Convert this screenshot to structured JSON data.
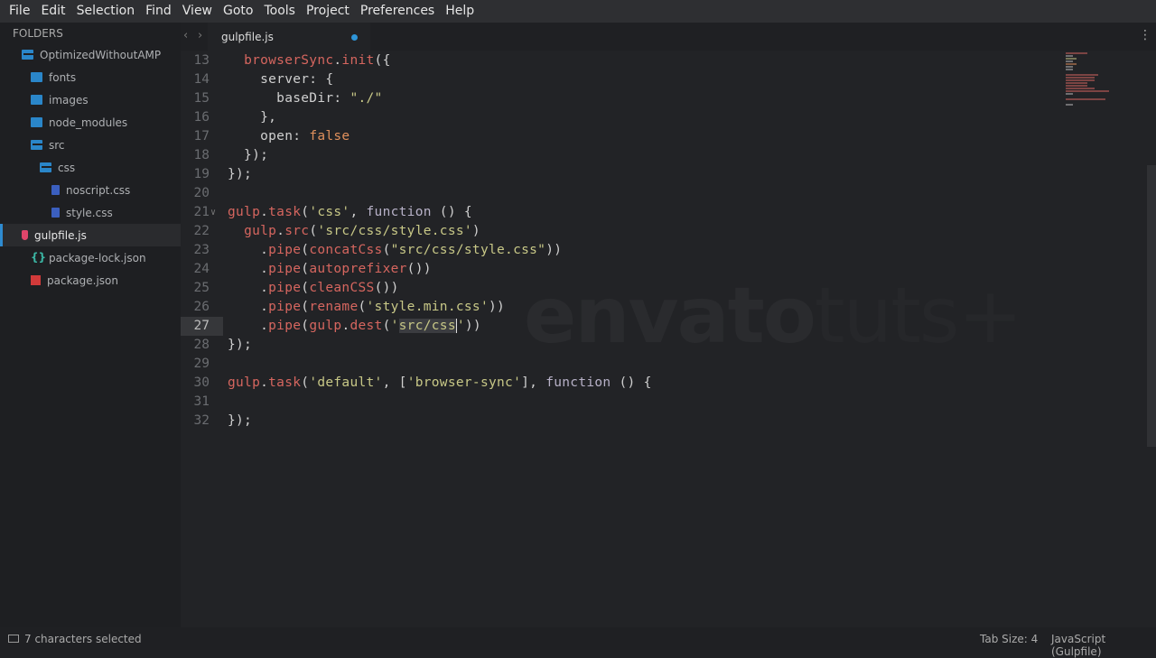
{
  "menu": [
    "File",
    "Edit",
    "Selection",
    "Find",
    "View",
    "Goto",
    "Tools",
    "Project",
    "Preferences",
    "Help"
  ],
  "sidebar": {
    "header": "FOLDERS",
    "items": [
      {
        "label": "OptimizedWithoutAMP",
        "icon": "folder-open-icon",
        "depth": 0
      },
      {
        "label": "fonts",
        "icon": "folder-icon",
        "depth": 1
      },
      {
        "label": "images",
        "icon": "folder-icon",
        "depth": 1
      },
      {
        "label": "node_modules",
        "icon": "folder-icon",
        "depth": 1
      },
      {
        "label": "src",
        "icon": "folder-open-icon",
        "depth": 1
      },
      {
        "label": "css",
        "icon": "folder-open-icon",
        "depth": 2
      },
      {
        "label": "noscript.css",
        "icon": "css-file-icon",
        "depth": 3
      },
      {
        "label": "style.css",
        "icon": "css-file-icon",
        "depth": 3
      },
      {
        "label": "gulpfile.js",
        "icon": "gulp-file-icon",
        "depth": 1,
        "active": true
      },
      {
        "label": "package-lock.json",
        "icon": "json-file-icon",
        "depth": 1
      },
      {
        "label": "package.json",
        "icon": "npm-file-icon",
        "depth": 1
      }
    ]
  },
  "tab": {
    "label": "gulpfile.js",
    "modified": true
  },
  "editor": {
    "current_line": 27,
    "lines": [
      {
        "n": "13",
        "t": [
          [
            "  ",
            ""
          ],
          [
            "browserSync",
            "fn"
          ],
          [
            ".",
            "p"
          ],
          [
            "init",
            "fn"
          ],
          [
            "({",
            "p"
          ]
        ]
      },
      {
        "n": "14",
        "t": [
          [
            "    server: {",
            "p"
          ]
        ]
      },
      {
        "n": "15",
        "t": [
          [
            "      baseDir: ",
            "p"
          ],
          [
            "\"./\"",
            "str"
          ]
        ]
      },
      {
        "n": "16",
        "t": [
          [
            "    },",
            "p"
          ]
        ]
      },
      {
        "n": "17",
        "t": [
          [
            "    open: ",
            "p"
          ],
          [
            "false",
            "const"
          ]
        ]
      },
      {
        "n": "18",
        "t": [
          [
            "  });",
            "p"
          ]
        ]
      },
      {
        "n": "19",
        "t": [
          [
            "});",
            "p"
          ]
        ]
      },
      {
        "n": "20",
        "t": []
      },
      {
        "n": "21",
        "fold": true,
        "t": [
          [
            "gulp",
            "fn"
          ],
          [
            ".",
            "p"
          ],
          [
            "task",
            "fn"
          ],
          [
            "(",
            "p"
          ],
          [
            "'css'",
            "str"
          ],
          [
            ", ",
            "p"
          ],
          [
            "function",
            "kw"
          ],
          [
            " () {",
            "p"
          ]
        ]
      },
      {
        "n": "22",
        "t": [
          [
            "  ",
            ""
          ],
          [
            "gulp",
            "fn"
          ],
          [
            ".",
            "p"
          ],
          [
            "src",
            "fn"
          ],
          [
            "(",
            "p"
          ],
          [
            "'src/css/style.css'",
            "str"
          ],
          [
            ")",
            "p"
          ]
        ]
      },
      {
        "n": "23",
        "t": [
          [
            "    .",
            "p"
          ],
          [
            "pipe",
            "fn"
          ],
          [
            "(",
            "p"
          ],
          [
            "concatCss",
            "fn"
          ],
          [
            "(",
            "p"
          ],
          [
            "\"src/css/style.css\"",
            "str"
          ],
          [
            "))",
            "p"
          ]
        ]
      },
      {
        "n": "24",
        "t": [
          [
            "    .",
            "p"
          ],
          [
            "pipe",
            "fn"
          ],
          [
            "(",
            "p"
          ],
          [
            "autoprefixer",
            "fn"
          ],
          [
            "())",
            "p"
          ]
        ]
      },
      {
        "n": "25",
        "t": [
          [
            "    .",
            "p"
          ],
          [
            "pipe",
            "fn"
          ],
          [
            "(",
            "p"
          ],
          [
            "cleanCSS",
            "fn"
          ],
          [
            "())",
            "p"
          ]
        ]
      },
      {
        "n": "26",
        "t": [
          [
            "    .",
            "p"
          ],
          [
            "pipe",
            "fn"
          ],
          [
            "(",
            "p"
          ],
          [
            "rename",
            "fn"
          ],
          [
            "(",
            "p"
          ],
          [
            "'style.min.css'",
            "str"
          ],
          [
            "))",
            "p"
          ]
        ]
      },
      {
        "n": "27",
        "t": [
          [
            "    .",
            "p"
          ],
          [
            "pipe",
            "fn"
          ],
          [
            "(",
            "p"
          ],
          [
            "gulp",
            "fn"
          ],
          [
            ".",
            "p"
          ],
          [
            "dest",
            "fn"
          ],
          [
            "(",
            "p"
          ],
          [
            "'",
            "str"
          ],
          [
            "src/css",
            "str sel caret"
          ],
          [
            "'",
            "str"
          ],
          [
            "))",
            "p"
          ]
        ]
      },
      {
        "n": "28",
        "t": [
          [
            "});",
            "p"
          ]
        ]
      },
      {
        "n": "29",
        "t": []
      },
      {
        "n": "30",
        "t": [
          [
            "gulp",
            "fn"
          ],
          [
            ".",
            "p"
          ],
          [
            "task",
            "fn"
          ],
          [
            "(",
            "p"
          ],
          [
            "'default'",
            "str"
          ],
          [
            ", [",
            "p"
          ],
          [
            "'browser-sync'",
            "str"
          ],
          [
            "], ",
            "p"
          ],
          [
            "function",
            "kw"
          ],
          [
            " () {",
            "p"
          ]
        ]
      },
      {
        "n": "31",
        "t": []
      },
      {
        "n": "32",
        "t": [
          [
            "});",
            "p"
          ]
        ]
      }
    ]
  },
  "watermark": {
    "a": "envato",
    "b": "tuts+"
  },
  "status": {
    "selection": "7 characters selected",
    "tab_size": "Tab Size: 4",
    "syntax": "JavaScript (Gulpfile)"
  },
  "colors": {
    "accent": "#2e95d8",
    "function": "#d6665f",
    "string": "#c8c887",
    "constant": "#e0905c"
  }
}
